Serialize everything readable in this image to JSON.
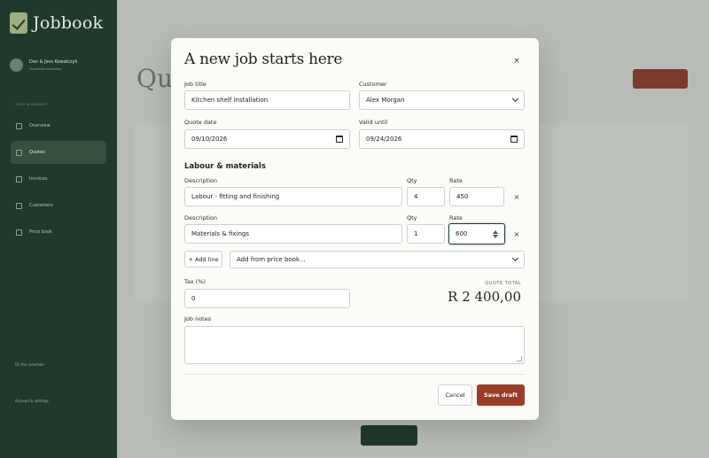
{
  "background": {
    "brand": "Jobbook",
    "user_name": "Dan & Jess Kowalczyk",
    "user_sub": "Household workshop",
    "section_label": "YOUR WORKSHOP",
    "nav": [
      "Overview",
      "Quotes",
      "Invoices",
      "Customers",
      "Price book"
    ],
    "footer_1": "On the schedule",
    "footer_2": "Account & settings",
    "page_title": "Quo"
  },
  "modal": {
    "title": "A new job starts here",
    "close_glyph": "×",
    "job_title_label": "Job title",
    "job_title_value": "Kitchen shelf installation",
    "customer_label": "Customer",
    "customer_value": "Alex Morgan",
    "quote_date_label": "Quote date",
    "quote_date_value": "09/10/2026",
    "valid_until_label": "Valid until",
    "valid_until_value": "09/24/2026",
    "section_title": "Labour & materials",
    "line_items": [
      {
        "desc_label": "Description",
        "qty_label": "Qty",
        "rate_label": "Rate",
        "description": "Labour - fitting and finishing",
        "qty": "4",
        "rate": "450"
      },
      {
        "desc_label": "Description",
        "qty_label": "Qty",
        "rate_label": "Rate",
        "description": "Materials & fixings",
        "qty": "1",
        "rate": "600"
      }
    ],
    "remove_glyph": "×",
    "add_line_label": "+ Add line",
    "price_book_placeholder": "Add from price book...",
    "tax_label": "Tax (%)",
    "tax_value": "0",
    "total_label": "QUOTE TOTAL",
    "total_value": "R 2 400,00",
    "notes_label": "Job notes",
    "cancel_label": "Cancel",
    "save_label": "Save draft"
  },
  "colors": {
    "brand_green": "#1f3a2c",
    "accent_red": "#9c3b26"
  }
}
